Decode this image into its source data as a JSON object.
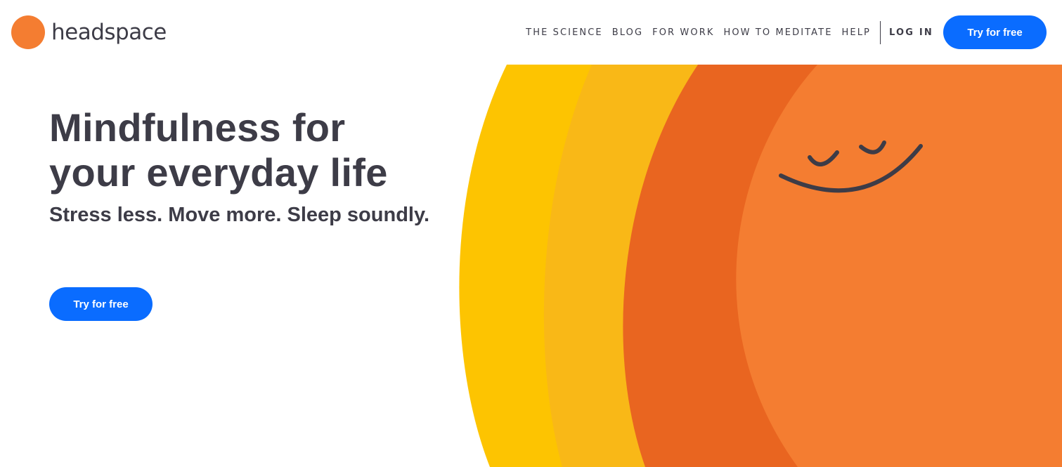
{
  "brand": {
    "name": "headspace",
    "logo_icon": "orange-circle-logo",
    "color": "#f47d31"
  },
  "nav": {
    "links": [
      "THE SCIENCE",
      "BLOG",
      "FOR WORK",
      "HOW TO MEDITATE",
      "HELP"
    ],
    "login_label": "LOG IN",
    "cta_label": "Try for free"
  },
  "hero": {
    "title_line1": "Mindfulness for",
    "title_line2": "your everyday life",
    "subtitle": "Stress less. Move more. Sleep soundly.",
    "cta_label": "Try for free"
  },
  "illustration": {
    "name": "smiling-sun-face",
    "colors": {
      "yellow": "#fdc401",
      "gold": "#f9b817",
      "dark_orange": "#e96520",
      "orange": "#f47d31",
      "face_line": "#3d3c47"
    }
  },
  "theme": {
    "accent": "#0a6cff",
    "text": "#3d3c47"
  }
}
